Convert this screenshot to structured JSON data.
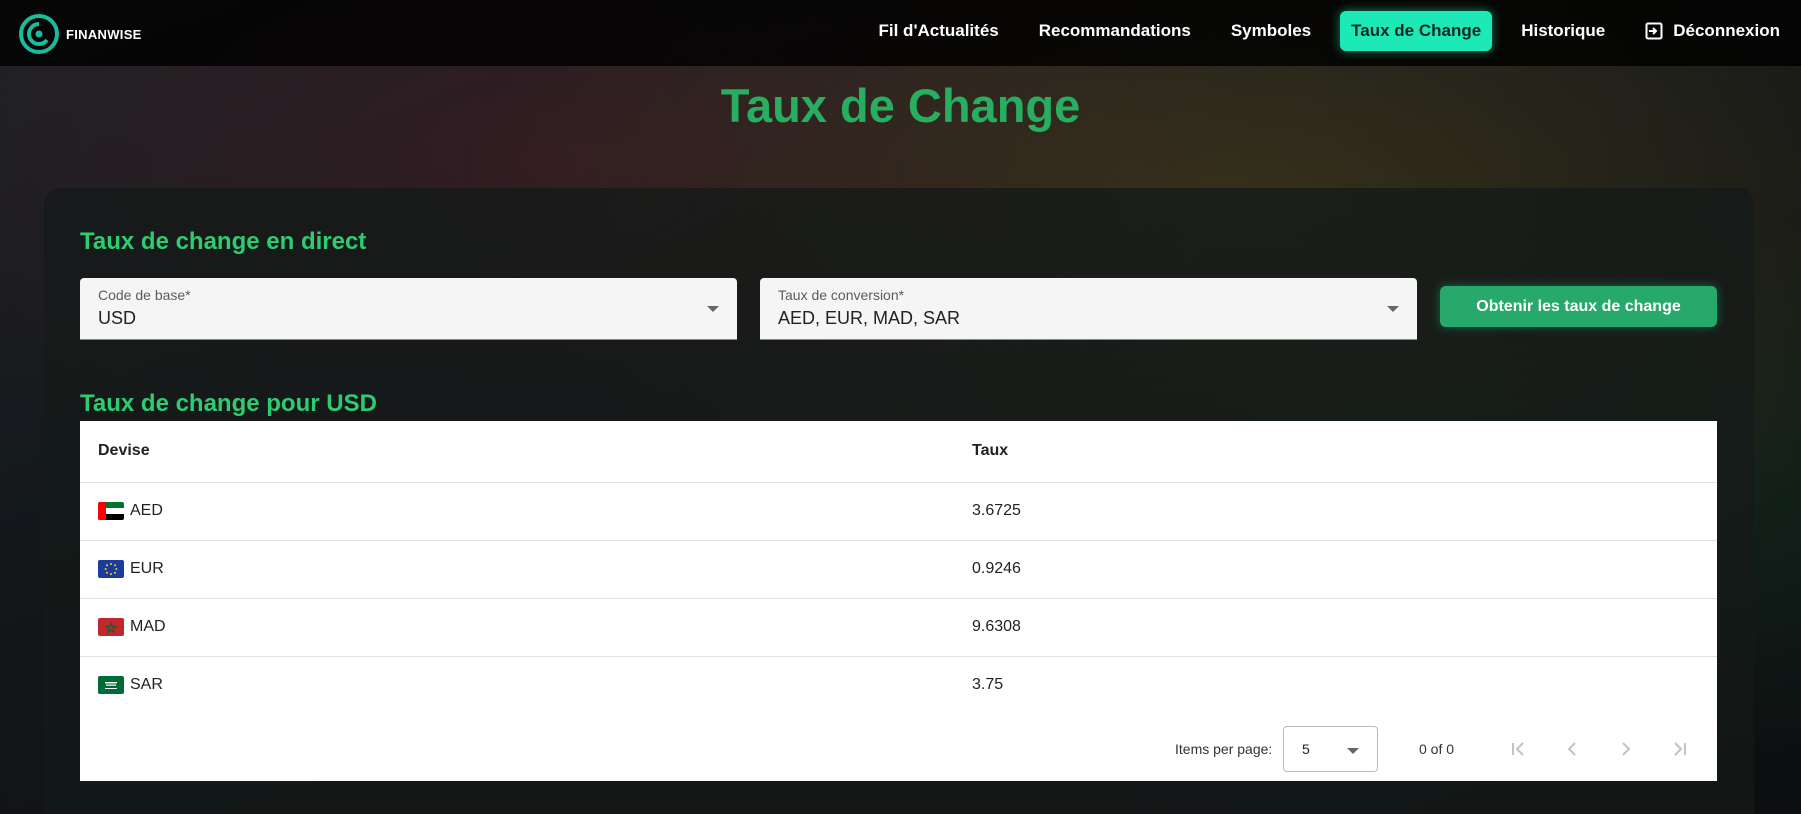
{
  "brand": {
    "name": "FINANWISE"
  },
  "nav": {
    "items": [
      {
        "label": "Fil d'Actualités"
      },
      {
        "label": "Recommandations"
      },
      {
        "label": "Symboles"
      },
      {
        "label": "Taux de Change",
        "active": true
      },
      {
        "label": "Historique"
      },
      {
        "label": "Déconnexion",
        "icon": "logout-icon"
      }
    ]
  },
  "page": {
    "title": "Taux de Change"
  },
  "live": {
    "title": "Taux de change en direct",
    "base_field": {
      "label": "Code de base*",
      "value": "USD"
    },
    "conversion_field": {
      "label": "Taux de conversion*",
      "value": "AED, EUR, MAD, SAR"
    },
    "button_label": "Obtenir les taux de change"
  },
  "rates": {
    "title": "Taux de change pour USD",
    "columns": [
      "Devise",
      "Taux"
    ],
    "rows": [
      {
        "code": "AED",
        "flag": "uae-flag-icon",
        "rate": "3.6725"
      },
      {
        "code": "EUR",
        "flag": "eu-flag-icon",
        "rate": "0.9246"
      },
      {
        "code": "MAD",
        "flag": "morocco-flag-icon",
        "rate": "9.6308"
      },
      {
        "code": "SAR",
        "flag": "saudi-flag-icon",
        "rate": "3.75"
      }
    ]
  },
  "paginator": {
    "items_per_page_label": "Items per page:",
    "items_per_page": "5",
    "range": "0 of 0"
  },
  "colors": {
    "accent": "#1de9b6",
    "title_green": "#27ae60",
    "button_green": "#26a96a"
  }
}
